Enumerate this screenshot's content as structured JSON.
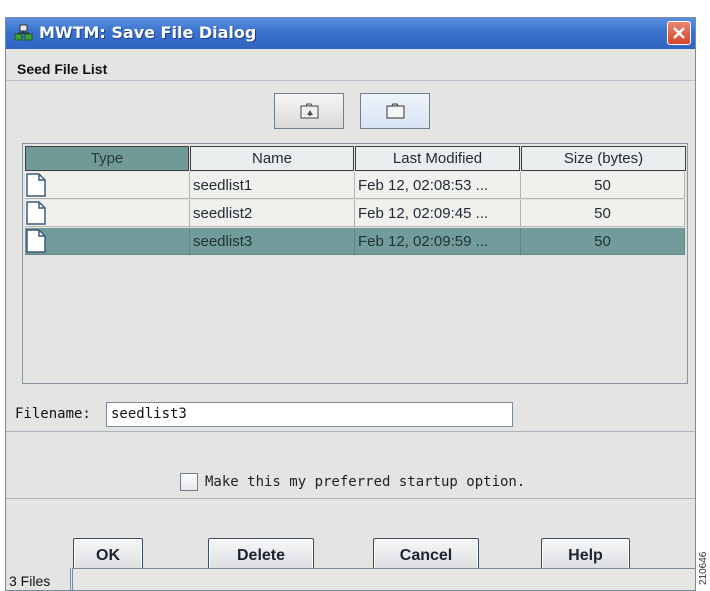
{
  "window": {
    "title": "MWTM: Save File Dialog",
    "icons": {
      "app": "app-network-icon",
      "close": "close-icon"
    },
    "accent_color": "#3a72cf"
  },
  "panel": {
    "title": "Seed File List"
  },
  "toolbar": {
    "buttons": [
      {
        "icon": "up-folder-icon"
      },
      {
        "icon": "new-folder-icon"
      }
    ]
  },
  "table": {
    "columns": [
      "Type",
      "Name",
      "Last Modified",
      "Size (bytes)"
    ],
    "rows": [
      {
        "type_icon": "file-icon",
        "name": "seedlist1",
        "modified": "Feb 12, 02:08:53 ...",
        "size": "50"
      },
      {
        "type_icon": "file-icon",
        "name": "seedlist2",
        "modified": "Feb 12, 02:09:45 ...",
        "size": "50"
      },
      {
        "type_icon": "file-icon",
        "name": "seedlist3",
        "modified": "Feb 12, 02:09:59 ...",
        "size": "50"
      }
    ],
    "selected_row": 2,
    "selection_color": "#729c9b"
  },
  "filename": {
    "label": "Filename:",
    "value": "seedlist3"
  },
  "option": {
    "label": "Make this my preferred startup option.",
    "checked": false
  },
  "buttons": {
    "ok": "OK",
    "delete": "Delete",
    "cancel": "Cancel",
    "help": "Help"
  },
  "status": {
    "text": "3 Files"
  },
  "side_id": "210646"
}
